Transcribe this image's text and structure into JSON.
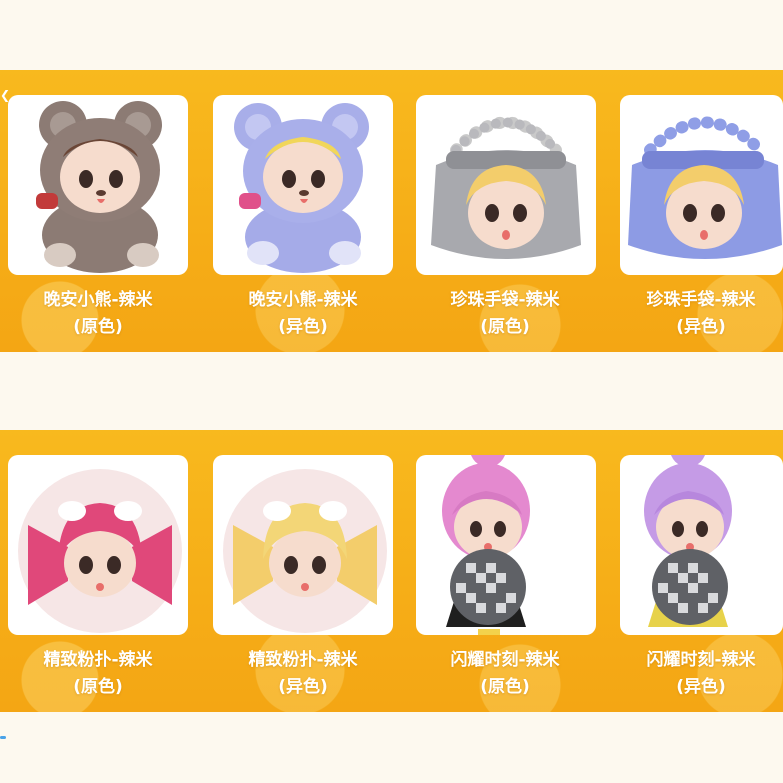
{
  "colors": {
    "background": "#fdf9ef",
    "band": "#f8b91e",
    "card": "#ffffff",
    "label_text": "#ffffff"
  },
  "products": [
    {
      "name": "晚安小熊-辣米",
      "variant": "(原色)",
      "icon": "brown-bear-suit-figure-icon"
    },
    {
      "name": "晚安小熊-辣米",
      "variant": "(异色)",
      "icon": "blue-bear-suit-figure-icon"
    },
    {
      "name": "珍珠手袋-辣米",
      "variant": "(原色)",
      "icon": "silver-pearl-handbag-figure-icon"
    },
    {
      "name": "珍珠手袋-辣米",
      "variant": "(异色)",
      "icon": "blue-pearl-handbag-figure-icon"
    },
    {
      "name": "精致粉扑-辣米",
      "variant": "(原色)",
      "icon": "pink-powder-puff-figure-icon"
    },
    {
      "name": "精致粉扑-辣米",
      "variant": "(异色)",
      "icon": "yellow-powder-puff-figure-icon"
    },
    {
      "name": "闪耀时刻-辣米",
      "variant": "(原色)",
      "icon": "pink-hair-disco-ball-figure-icon"
    },
    {
      "name": "闪耀时刻-辣米",
      "variant": "(异色)",
      "icon": "purple-hair-disco-ball-figure-icon"
    }
  ]
}
